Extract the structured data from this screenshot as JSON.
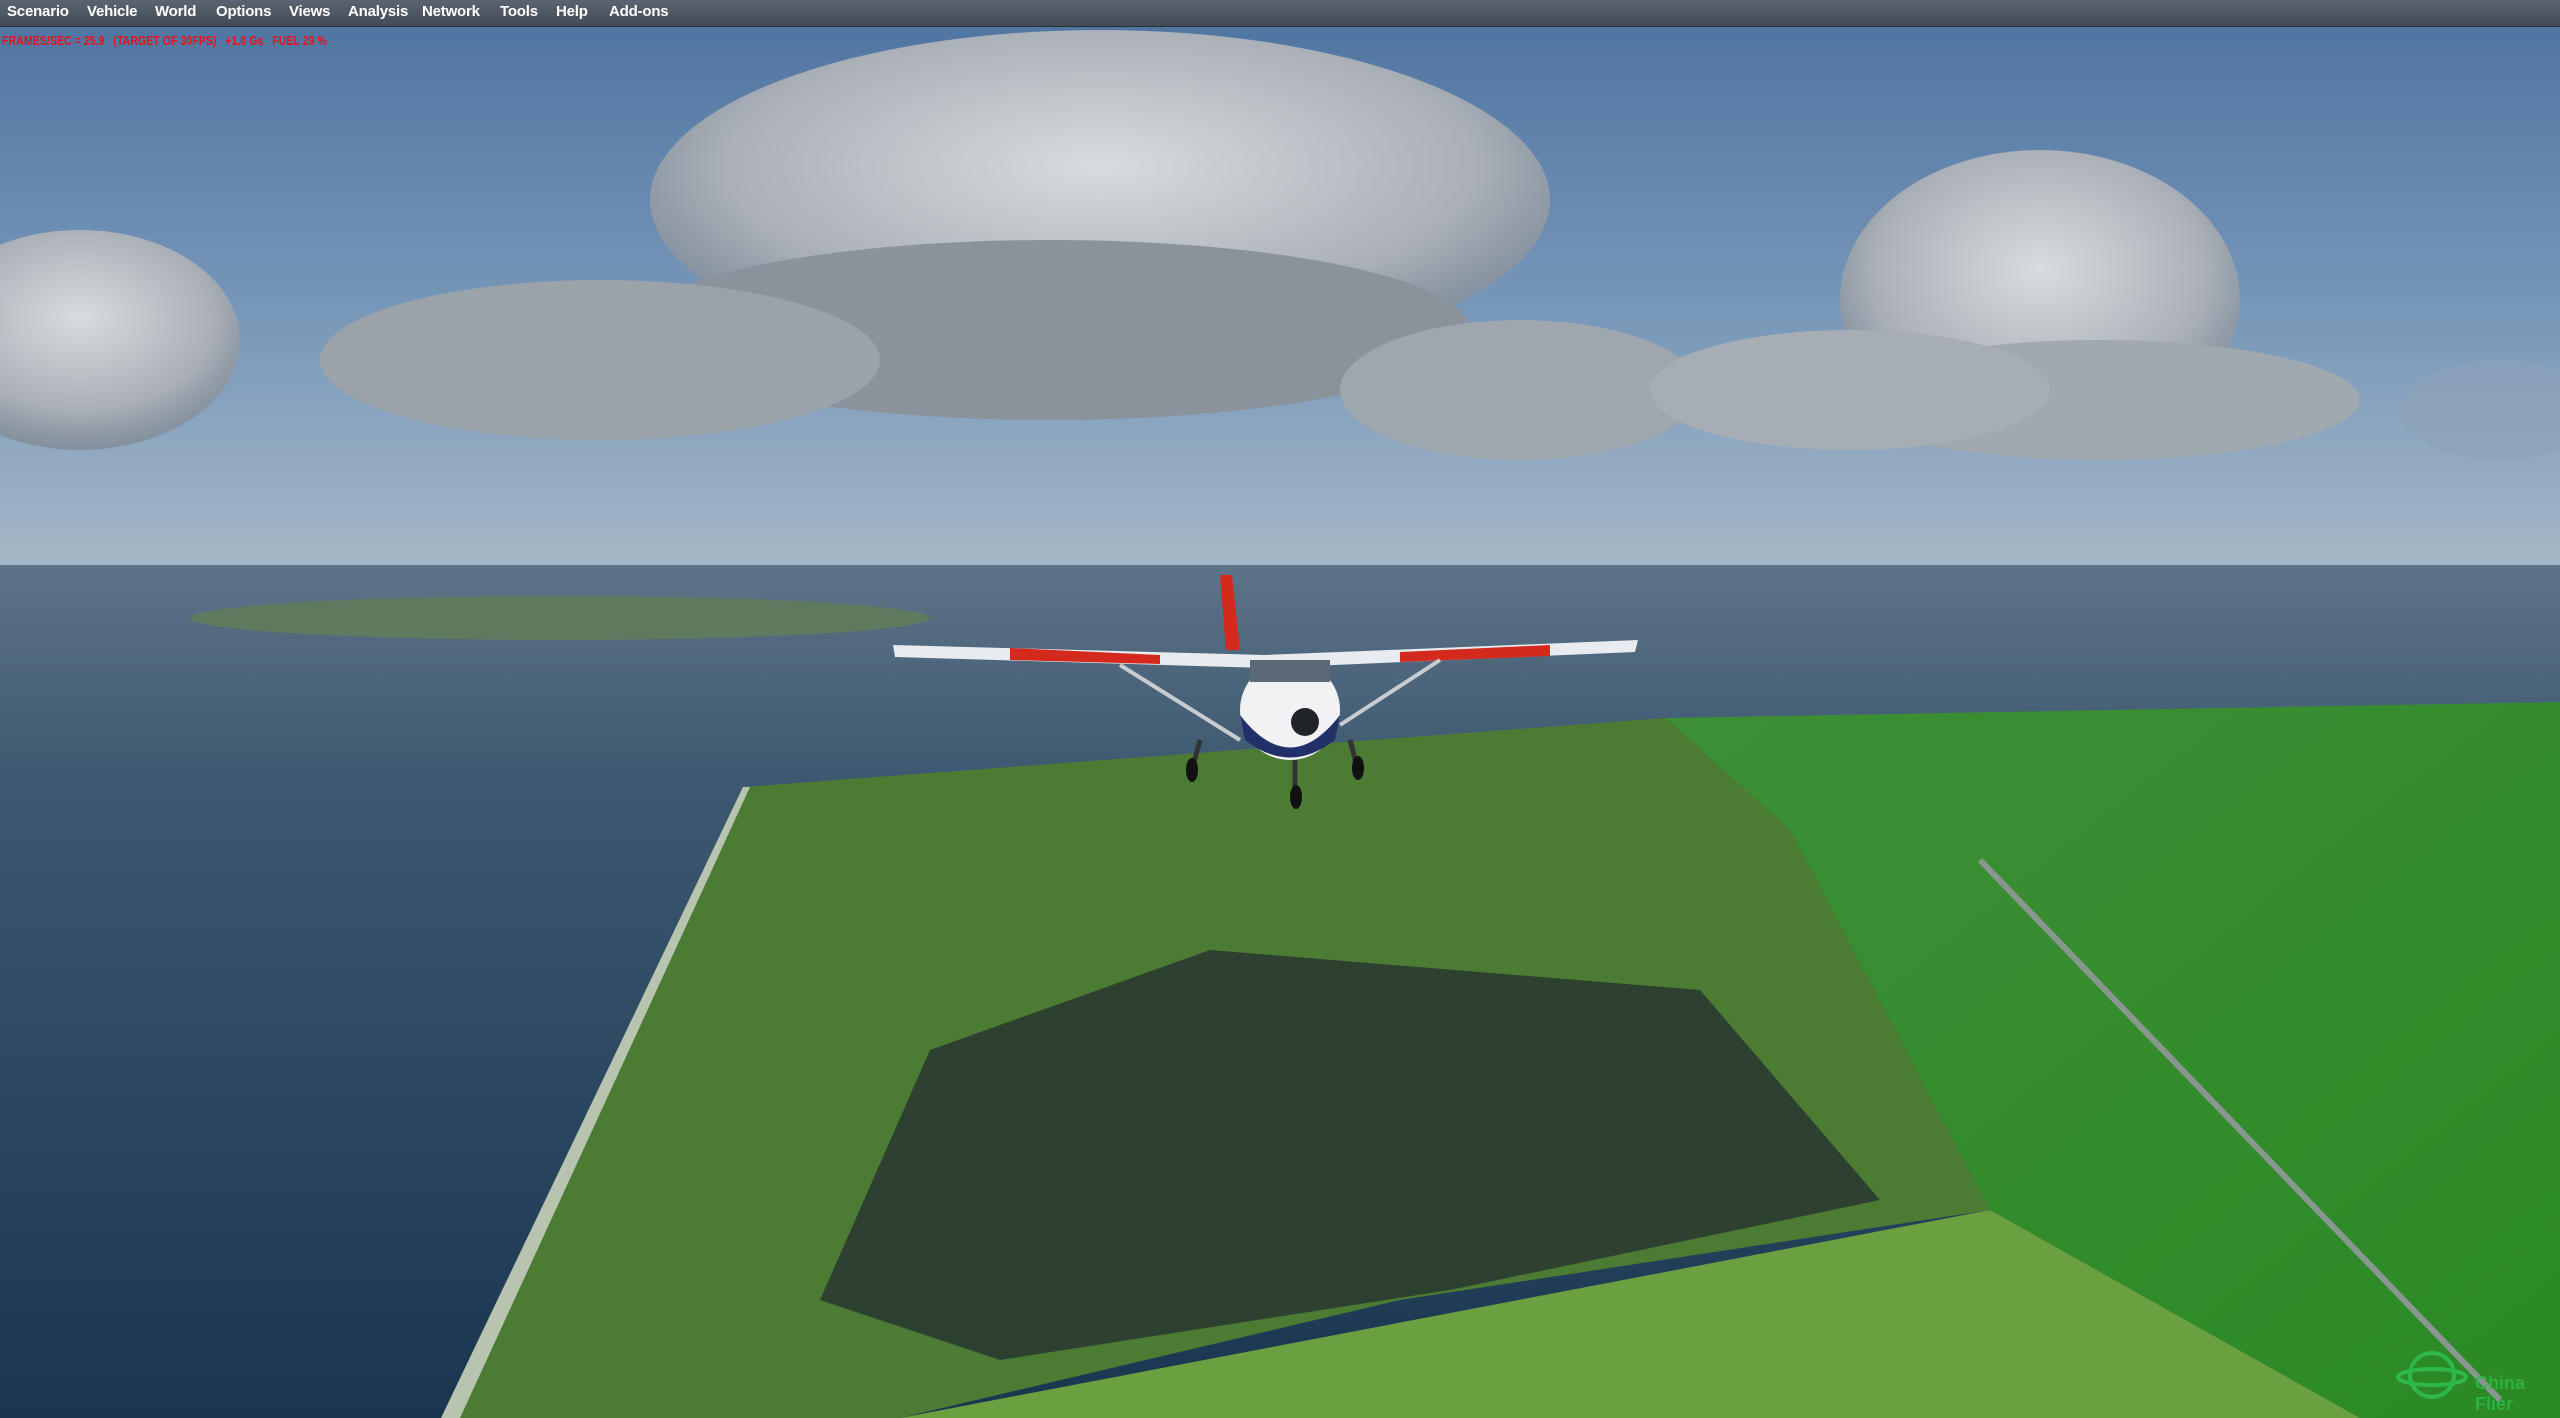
{
  "menu": {
    "items": [
      {
        "label": "Scenario"
      },
      {
        "label": "Vehicle"
      },
      {
        "label": "World"
      },
      {
        "label": "Options"
      },
      {
        "label": "Views"
      },
      {
        "label": "Analysis"
      },
      {
        "label": "Network"
      },
      {
        "label": "Tools"
      },
      {
        "label": "Help"
      },
      {
        "label": "Add-ons"
      }
    ]
  },
  "hud": {
    "text": "FRAMES/SEC = 25.9   (TARGET OF 30FPS)   +1.0 Gs   FUEL 29 %",
    "color": "#e3141c"
  },
  "watermark": {
    "text": "China Flier",
    "color": "#2fb84a"
  },
  "colors": {
    "sky_top": "#5b7fa8",
    "sky_horizon": "#9fb4c4",
    "sea": "#2c4a66",
    "land_green": "#4f8a2e",
    "farmland": "#2f8f2a"
  }
}
